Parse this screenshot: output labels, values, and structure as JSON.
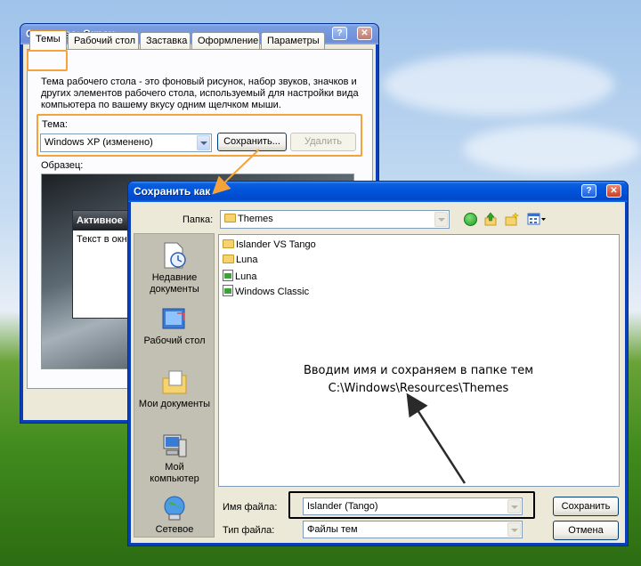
{
  "display_props": {
    "title": "Свойства: Экран",
    "title_buttons": [
      "?",
      "✕"
    ],
    "tabs": [
      "Темы",
      "Рабочий стол",
      "Заставка",
      "Оформление",
      "Параметры"
    ],
    "description": "Тема рабочего стола - это фоновый рисунок, набор звуков, значков и других элементов рабочего стола, используемый для настройки вида компьютера по вашему вкусу одним щелчком мыши.",
    "theme_label": "Тема:",
    "theme_value": "Windows XP (изменено)",
    "save_button": "Сохранить...",
    "delete_button": "Удалить",
    "sample_label": "Образец:",
    "preview_window_title": "Активное",
    "preview_window_text": "Текст в окн"
  },
  "save_dialog": {
    "title": "Сохранить как",
    "title_buttons": [
      "?",
      "✕"
    ],
    "folder_label": "Папка:",
    "folder_value": "Themes",
    "places": [
      {
        "icon": "recent-documents-icon",
        "label": "Недавние документы"
      },
      {
        "icon": "desktop-icon",
        "label": "Рабочий стол"
      },
      {
        "icon": "my-documents-icon",
        "label": "Мои документы"
      },
      {
        "icon": "my-computer-icon",
        "label": "Мой компьютер"
      },
      {
        "icon": "network-icon",
        "label": "Сетевое"
      }
    ],
    "files": [
      {
        "icon": "folder-icon",
        "name": "Islander VS Tango"
      },
      {
        "icon": "folder-icon",
        "name": "Luna"
      },
      {
        "icon": "theme-file-icon",
        "name": "Luna"
      },
      {
        "icon": "theme-file-icon",
        "name": "Windows Classic"
      }
    ],
    "annotation_line1": "Вводим имя и сохраняем в папке тем",
    "annotation_line2": "C:\\Windows\\Resources\\Themes",
    "filename_label": "Имя файла:",
    "filename_value": "Islander (Tango)",
    "filetype_label": "Тип файла:",
    "filetype_value": "Файлы тем",
    "save_button": "Сохранить",
    "cancel_button": "Отмена"
  },
  "colors": {
    "highlight_orange": "#f6a23a",
    "xp_title_blue": "#0053d9"
  }
}
